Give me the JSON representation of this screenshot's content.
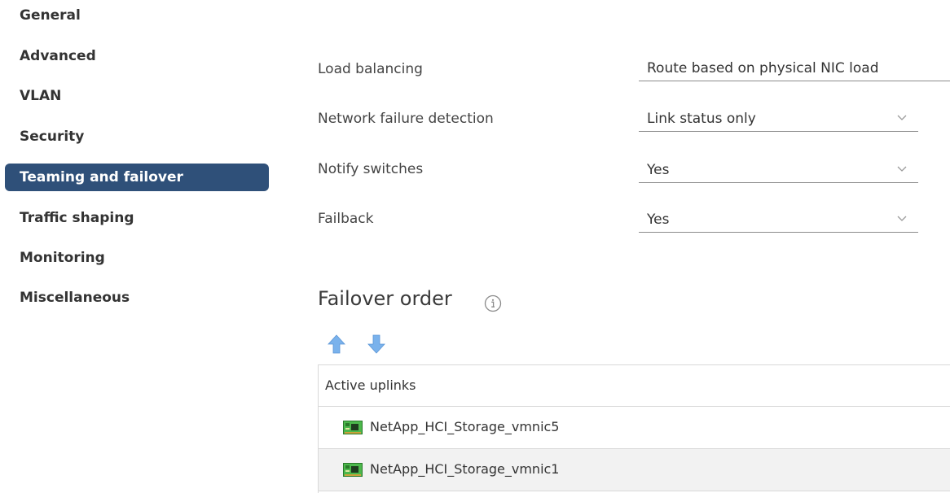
{
  "sidebar": {
    "items": [
      {
        "label": "General"
      },
      {
        "label": "Advanced"
      },
      {
        "label": "VLAN"
      },
      {
        "label": "Security"
      },
      {
        "label": "Teaming and failover",
        "active": true
      },
      {
        "label": "Traffic shaping"
      },
      {
        "label": "Monitoring"
      },
      {
        "label": "Miscellaneous"
      }
    ]
  },
  "form": {
    "load_balancing": {
      "label": "Load balancing",
      "value": "Route based on physical NIC load"
    },
    "failure_detection": {
      "label": "Network failure detection",
      "value": "Link status only"
    },
    "notify_switches": {
      "label": "Notify switches",
      "value": "Yes"
    },
    "failback": {
      "label": "Failback",
      "value": "Yes"
    }
  },
  "failover": {
    "title": "Failover order",
    "info_icon": "info-circle-icon",
    "move_up_icon": "arrow-up-icon",
    "move_down_icon": "arrow-down-icon",
    "table": {
      "header": "Active uplinks",
      "rows": [
        {
          "label": "NetApp_HCI_Storage_vmnic5"
        },
        {
          "label": "NetApp_HCI_Storage_vmnic1"
        }
      ]
    }
  },
  "colors": {
    "active_nav_bg": "#2f5079",
    "arrow_blue": "#6fa8e8",
    "nic_green": "#3fae3f"
  }
}
